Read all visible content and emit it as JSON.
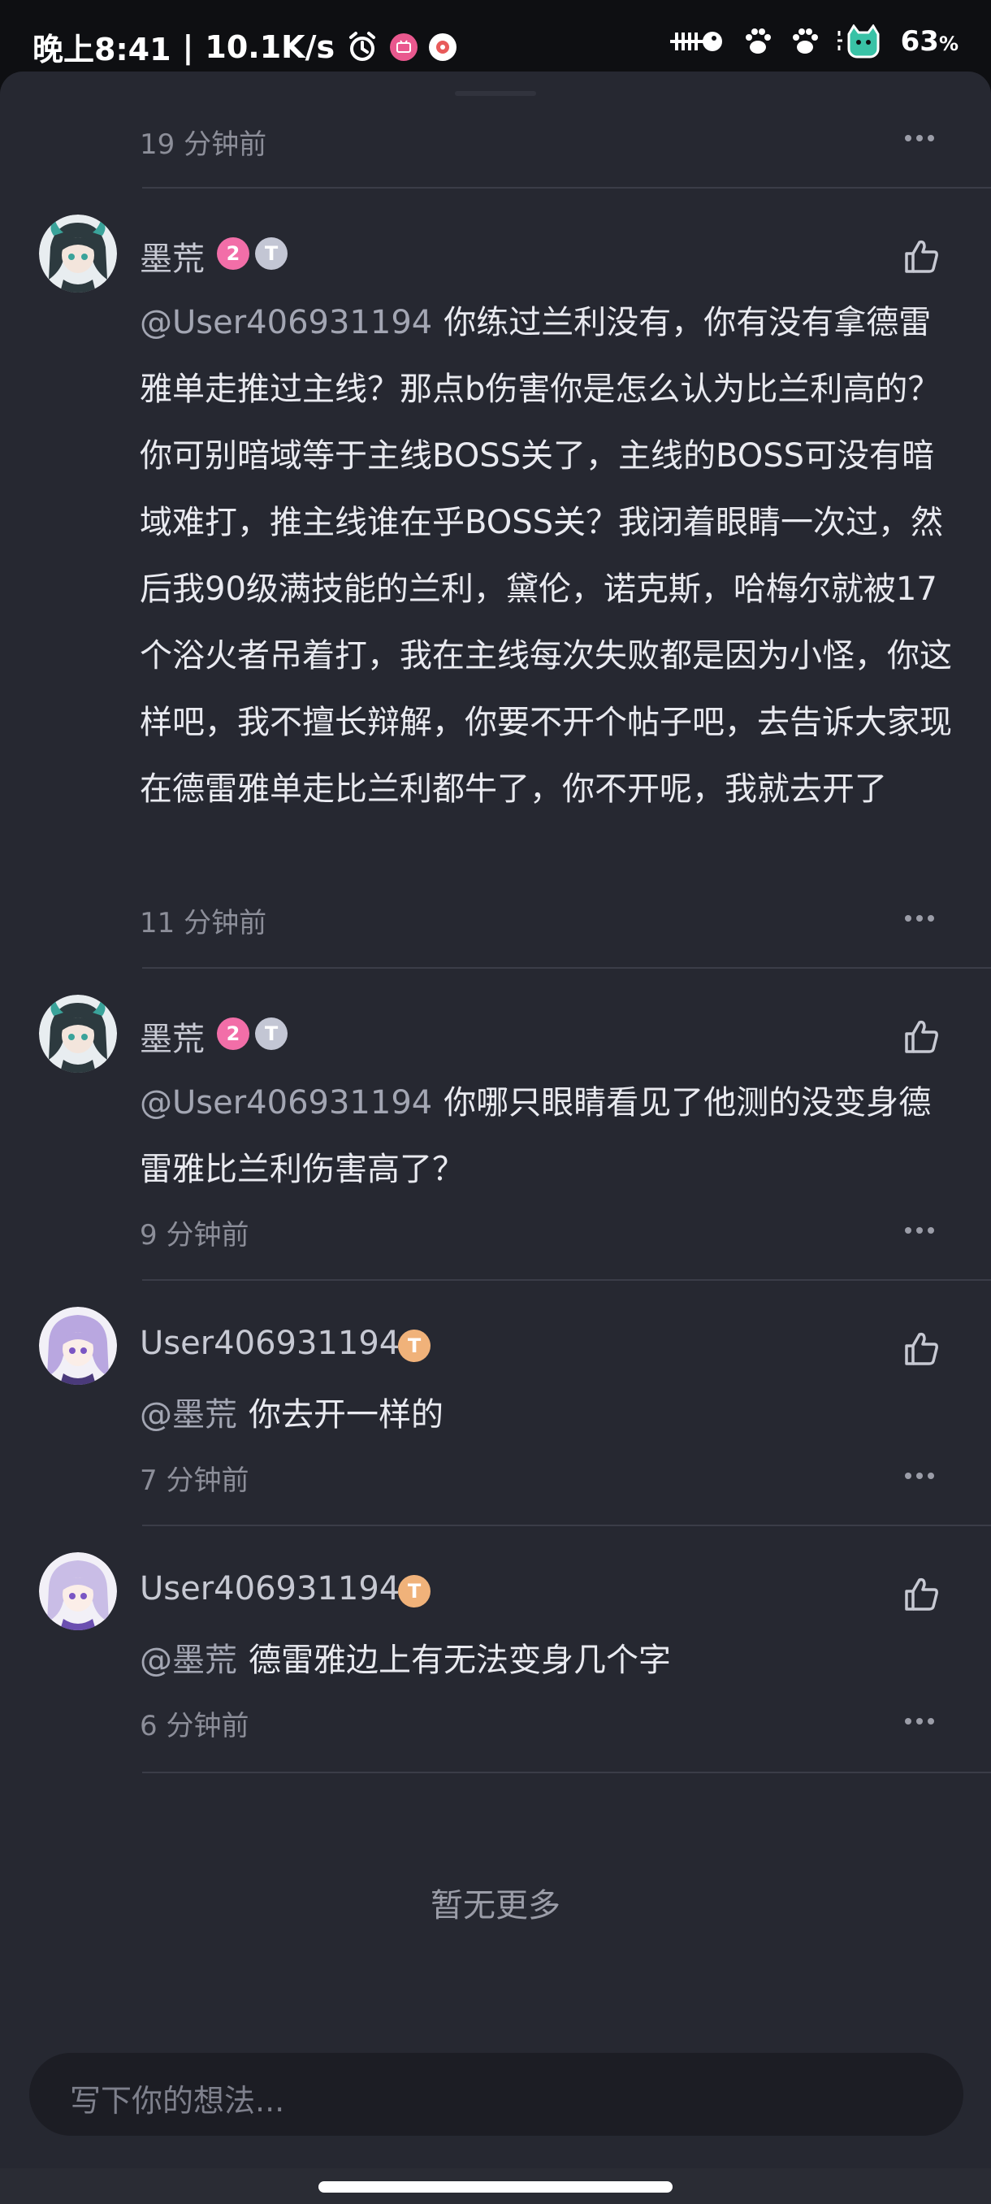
{
  "status_bar": {
    "time": "晚上8:41",
    "separator": "|",
    "network_speed": "10.1K/s",
    "battery": "63",
    "battery_unit": "%"
  },
  "comments": [
    {
      "time": "19 分钟前"
    },
    {
      "username": "墨荒",
      "level": "2",
      "badge_t": "T",
      "mention": "@User406931194",
      "text": "你练过兰利没有，你有没有拿德雷雅单走推过主线？那点b伤害你是怎么认为比兰利高的？你可别暗域等于主线BOSS关了，主线的BOSS可没有暗域难打，推主线谁在乎BOSS关？我闭着眼睛一次过，然后我90级满技能的兰利，黛伦，诺克斯，哈梅尔就被17个浴火者吊着打，我在主线每次失败都是因为小怪，你这样吧，我不擅长辩解，你要不开个帖子吧，去告诉大家现在德雷雅单走比兰利都牛了，你不开呢，我就去开了",
      "time": "11 分钟前"
    },
    {
      "username": "墨荒",
      "level": "2",
      "badge_t": "T",
      "mention": "@User406931194",
      "text": "你哪只眼睛看见了他测的没变身德雷雅比兰利伤害高了？",
      "time": "9 分钟前"
    },
    {
      "username": "User406931194",
      "badge_t": "T",
      "mention": "@墨荒",
      "text": "你去开一样的",
      "time": "7 分钟前"
    },
    {
      "username": "User406931194",
      "badge_t": "T",
      "mention": "@墨荒",
      "text": "德雷雅边上有无法变身几个字",
      "time": "6 分钟前"
    }
  ],
  "end_text": "暂无更多",
  "input": {
    "placeholder": "写下你的想法..."
  },
  "colors": {
    "sheet_bg": "#262831",
    "status_bg": "#0e0f12",
    "text_primary": "#e9eaf0",
    "text_secondary": "#8c8e99",
    "level_badge": "#f26ea8",
    "silver_badge": "#c3c6d4",
    "gold_badge": "#f0b27a"
  }
}
